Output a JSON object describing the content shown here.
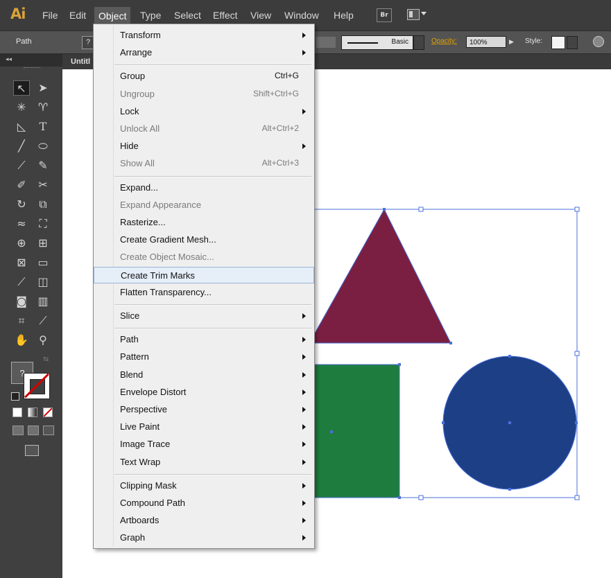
{
  "app": {
    "logo": "Ai"
  },
  "menubar": {
    "items": [
      "File",
      "Edit",
      "Object",
      "Type",
      "Select",
      "Effect",
      "View",
      "Window",
      "Help"
    ],
    "active": "Object",
    "bridge_label": "Br"
  },
  "controlbar": {
    "selection_label": "Path",
    "fill_label": "?",
    "stroke_profile": "Basic",
    "opacity_label": "Opacity:",
    "opacity_value": "100%",
    "style_label": "Style:"
  },
  "tab": {
    "title": "Untitl"
  },
  "toolspanel": {
    "fill_label": "?",
    "tools": [
      "selection-tool",
      "direct-selection-tool",
      "magic-wand-tool",
      "lasso-tool",
      "pen-tool",
      "type-tool",
      "line-segment-tool",
      "ellipse-tool",
      "paintbrush-tool",
      "pencil-tool",
      "blob-brush-tool",
      "scissors-tool",
      "rotate-tool",
      "scale-tool",
      "width-tool",
      "free-transform-tool",
      "shape-builder-tool",
      "perspective-grid-tool",
      "mesh-tool",
      "gradient-tool",
      "eyedropper-tool",
      "blend-tool",
      "symbol-sprayer-tool",
      "column-graph-tool",
      "artboard-tool",
      "slice-tool",
      "hand-tool",
      "zoom-tool"
    ]
  },
  "object_menu": {
    "items": [
      {
        "label": "Transform",
        "submenu": true
      },
      {
        "label": "Arrange",
        "submenu": true
      },
      {
        "sep": true
      },
      {
        "label": "Group",
        "shortcut": "Ctrl+G"
      },
      {
        "label": "Ungroup",
        "shortcut": "Shift+Ctrl+G",
        "disabled": true
      },
      {
        "label": "Lock",
        "submenu": true
      },
      {
        "label": "Unlock All",
        "shortcut": "Alt+Ctrl+2",
        "disabled": true
      },
      {
        "label": "Hide",
        "submenu": true
      },
      {
        "label": "Show All",
        "shortcut": "Alt+Ctrl+3",
        "disabled": true
      },
      {
        "sep": true
      },
      {
        "label": "Expand..."
      },
      {
        "label": "Expand Appearance",
        "disabled": true
      },
      {
        "label": "Rasterize..."
      },
      {
        "label": "Create Gradient Mesh..."
      },
      {
        "label": "Create Object Mosaic...",
        "disabled": true
      },
      {
        "label": "Create Trim Marks",
        "highlighted": true
      },
      {
        "label": "Flatten Transparency..."
      },
      {
        "sep": true
      },
      {
        "label": "Slice",
        "submenu": true
      },
      {
        "sep": true
      },
      {
        "label": "Path",
        "submenu": true
      },
      {
        "label": "Pattern",
        "submenu": true
      },
      {
        "label": "Blend",
        "submenu": true
      },
      {
        "label": "Envelope Distort",
        "submenu": true
      },
      {
        "label": "Perspective",
        "submenu": true
      },
      {
        "label": "Live Paint",
        "submenu": true
      },
      {
        "label": "Image Trace",
        "submenu": true
      },
      {
        "label": "Text Wrap",
        "submenu": true
      },
      {
        "sep": true
      },
      {
        "label": "Clipping Mask",
        "submenu": true
      },
      {
        "label": "Compound Path",
        "submenu": true
      },
      {
        "label": "Artboards",
        "submenu": true
      },
      {
        "label": "Graph",
        "submenu": true
      }
    ]
  },
  "artwork": {
    "triangle_color": "#7b1f42",
    "square_color": "#1e7d3e",
    "circle_color": "#1d3f86",
    "selection_color": "#4a6fd8"
  }
}
